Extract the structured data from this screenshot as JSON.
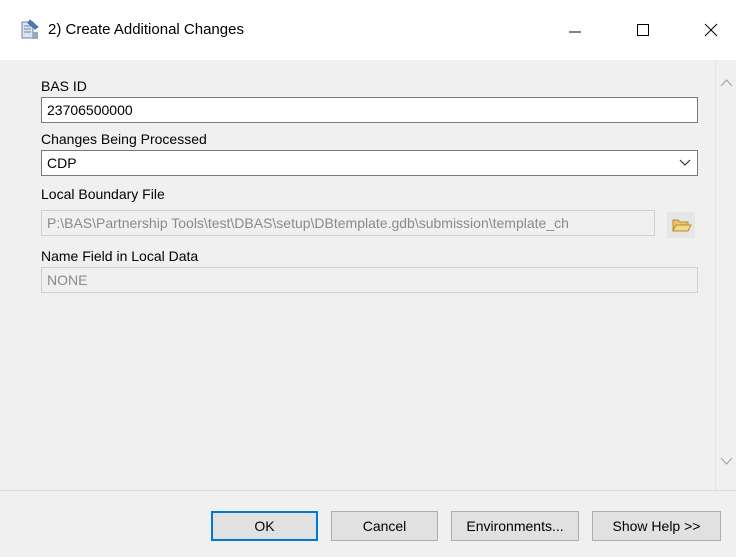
{
  "window": {
    "title": "2) Create Additional Changes",
    "controls": {
      "minimize": "minimize",
      "maximize": "maximize",
      "close": "close"
    }
  },
  "form": {
    "bas_id": {
      "label": "BAS ID",
      "value": "23706500000"
    },
    "changes": {
      "label": "Changes Being Processed",
      "value": "CDP"
    },
    "boundary_file": {
      "label": "Local Boundary File",
      "value": "P:\\BAS\\Partnership Tools\\test\\DBAS\\setup\\DBtemplate.gdb\\submission\\template_ch"
    },
    "name_field": {
      "label": "Name Field in Local Data",
      "value": "NONE"
    }
  },
  "buttons": {
    "ok": "OK",
    "cancel": "Cancel",
    "environments": "Environments...",
    "show_help": "Show Help >>"
  },
  "colors": {
    "focus_border": "#0078d7",
    "folder_icon": "#e8c46a"
  }
}
